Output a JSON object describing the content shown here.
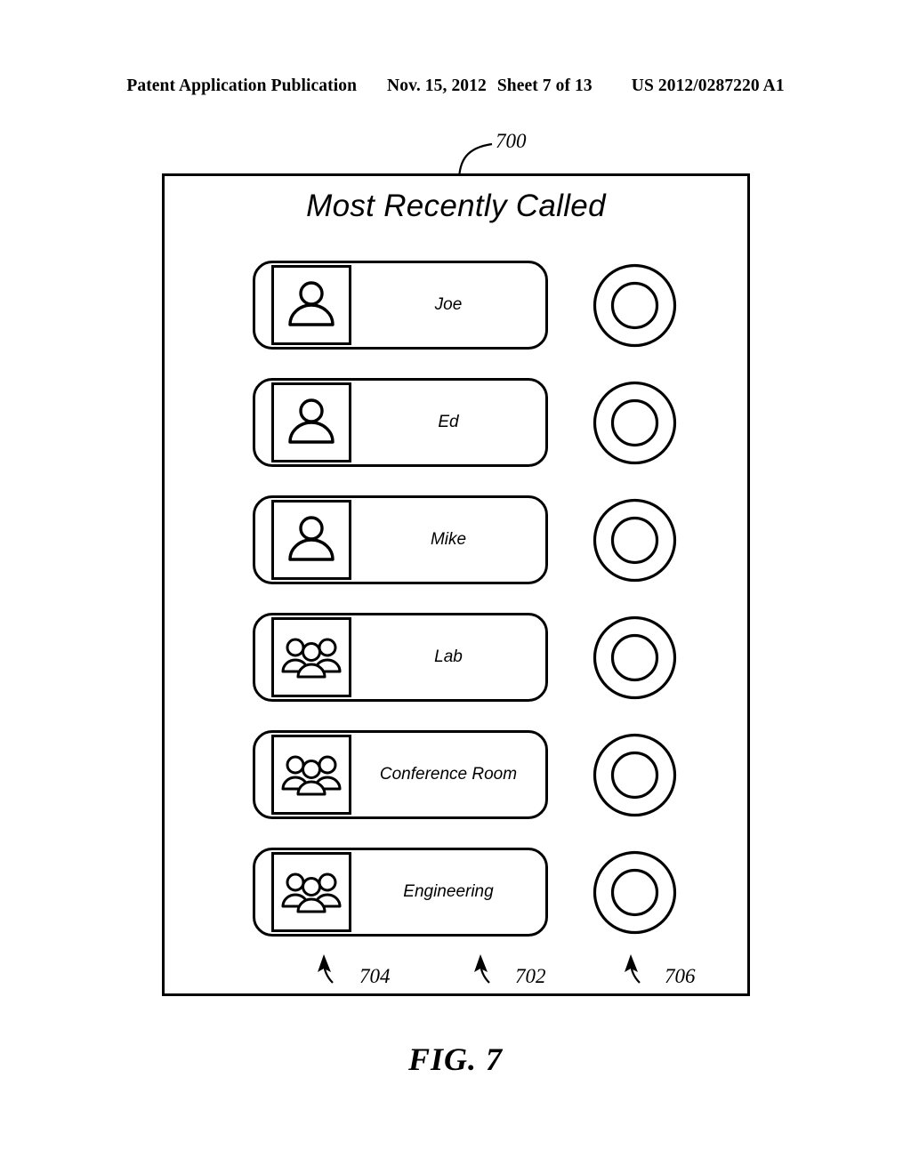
{
  "page": {
    "header": {
      "publication": "Patent Application Publication",
      "date": "Nov. 15, 2012",
      "sheet": "Sheet 7 of 13",
      "patent_number": "US 2012/0287220 A1"
    },
    "figure_caption": "FIG. 7"
  },
  "device": {
    "reference_numeral": "700",
    "screen_title": "Most Recently Called"
  },
  "contacts": [
    {
      "name": "Joe",
      "avatar_icon": "person-icon",
      "indicator_icon": "call-ring-icon"
    },
    {
      "name": "Ed",
      "avatar_icon": "person-icon",
      "indicator_icon": "call-ring-icon"
    },
    {
      "name": "Mike",
      "avatar_icon": "person-icon",
      "indicator_icon": "call-ring-icon"
    },
    {
      "name": "Lab",
      "avatar_icon": "group-icon",
      "indicator_icon": "call-ring-icon"
    },
    {
      "name": "Conference Room",
      "avatar_icon": "group-icon",
      "indicator_icon": "call-ring-icon"
    },
    {
      "name": "Engineering",
      "avatar_icon": "group-icon",
      "indicator_icon": "call-ring-icon"
    }
  ],
  "callouts": [
    {
      "numeral": "704",
      "points_to": "avatar-image-area"
    },
    {
      "numeral": "702",
      "points_to": "contact-name-area"
    },
    {
      "numeral": "706",
      "points_to": "call-indicator-area"
    }
  ],
  "colors": {
    "line": "#000000",
    "background": "#ffffff"
  }
}
